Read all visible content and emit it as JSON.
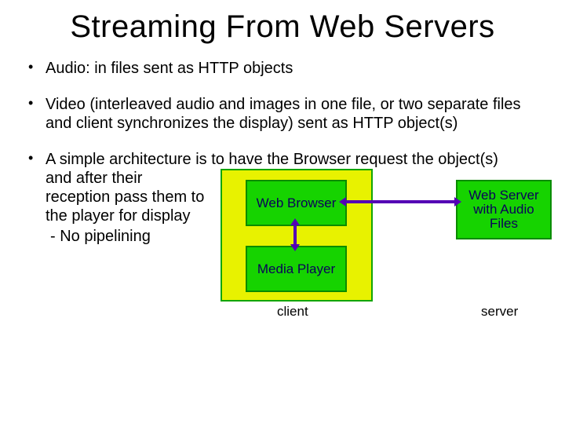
{
  "title": "Streaming From Web Servers",
  "bullets": {
    "b1": "Audio: in files sent as HTTP objects",
    "b2": "Video (interleaved audio and images in one file, or two separate files and client synchronizes the display) sent as HTTP object(s)",
    "b3_lead": "A simple architecture is to have the Browser request the object(s)",
    "b3_rest": "and after their reception pass them to the player for display",
    "b3_sub": "- No pipelining"
  },
  "diagram": {
    "web_browser": "Web Browser",
    "media_player": "Media Player",
    "server_box": "Web Server with Audio Files",
    "caption_client": "client",
    "caption_server": "server"
  }
}
